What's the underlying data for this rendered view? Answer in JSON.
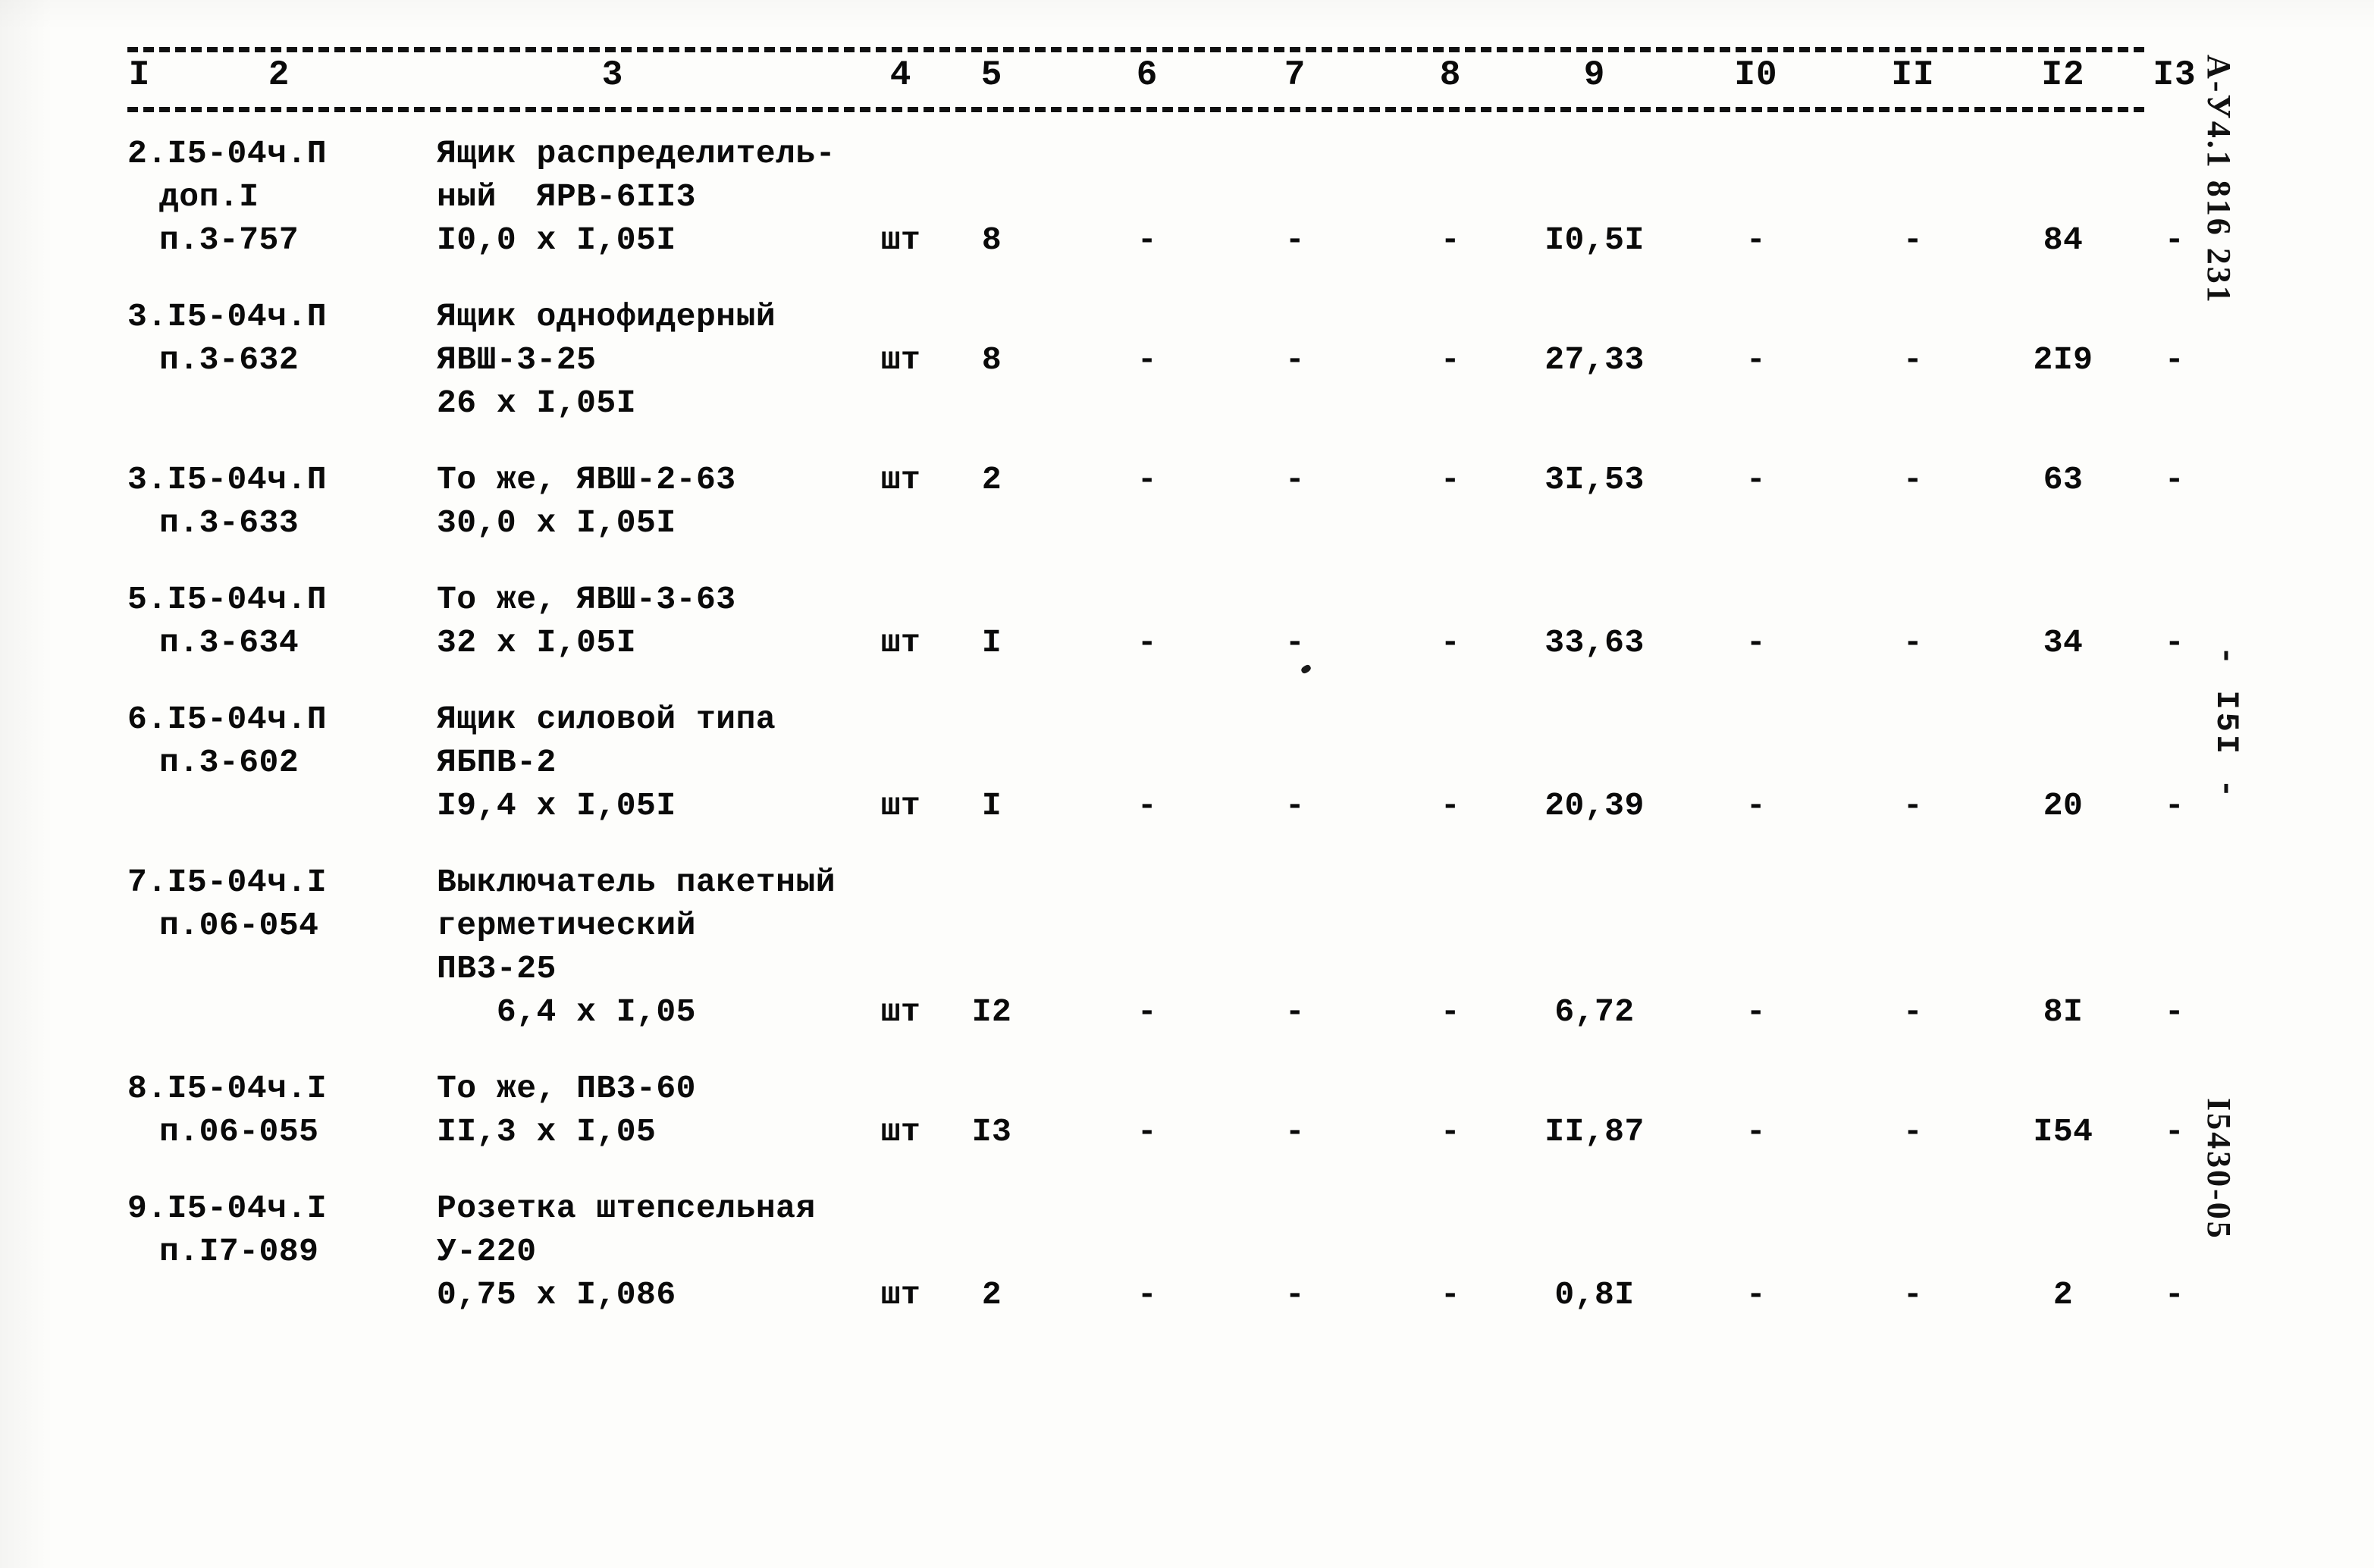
{
  "document": {
    "type": "estimate-table",
    "column_headers": [
      "I",
      "2",
      "3",
      "4",
      "5",
      "6",
      "7",
      "8",
      "9",
      "I0",
      "II",
      "I2",
      "I3"
    ],
    "margin": {
      "top_code": "А-У4.1 816 231",
      "page_number": "- I5I -",
      "bottom_code": "I5430-05"
    }
  },
  "rows": [
    {
      "code_lines": [
        "2.I5-04ч.П",
        "доп.I",
        "п.3-757"
      ],
      "desc_lines": [
        "Ящик распределитель-",
        "ный  ЯРВ-6II3",
        "I0,0 x I,05I"
      ],
      "unit": "шт",
      "qty": "8",
      "c6": "-",
      "c7": "-",
      "c8": "-",
      "c9": "I0,5I",
      "c10": "-",
      "c11": "-",
      "c12": "84",
      "c13": "-",
      "value_line": 2
    },
    {
      "code_lines": [
        "3.I5-04ч.П",
        "п.3-632"
      ],
      "desc_lines": [
        "Ящик однофидерный",
        "ЯВШ-3-25",
        "26 x I,05I"
      ],
      "unit": "шт",
      "qty": "8",
      "c6": "-",
      "c7": "-",
      "c8": "-",
      "c9": "27,33",
      "c10": "-",
      "c11": "-",
      "c12": "2I9",
      "c13": "-",
      "value_line": 1
    },
    {
      "code_lines": [
        "3.I5-04ч.П",
        "п.3-633"
      ],
      "desc_lines": [
        "То же, ЯВШ-2-63",
        "30,0 x I,05I"
      ],
      "unit": "шт",
      "qty": "2",
      "c6": "-",
      "c7": "-",
      "c8": "-",
      "c9": "3I,53",
      "c10": "-",
      "c11": "-",
      "c12": "63",
      "c13": "-",
      "value_line": 0
    },
    {
      "code_lines": [
        "5.I5-04ч.П",
        "п.3-634"
      ],
      "desc_lines": [
        "То же, ЯВШ-3-63",
        "32 x I,05I"
      ],
      "unit": "шт",
      "qty": "I",
      "c6": "-",
      "c7": "-",
      "c8": "-",
      "c9": "33,63",
      "c10": "-",
      "c11": "-",
      "c12": "34",
      "c13": "-",
      "value_line": 1
    },
    {
      "code_lines": [
        "6.I5-04ч.П",
        "п.3-602"
      ],
      "desc_lines": [
        "Ящик силовой типа",
        "ЯБПВ-2",
        "I9,4 x I,05I"
      ],
      "unit": "шт",
      "qty": "I",
      "c6": "-",
      "c7": "-",
      "c8": "-",
      "c9": "20,39",
      "c10": "-",
      "c11": "-",
      "c12": "20",
      "c13": "-",
      "value_line": 2
    },
    {
      "code_lines": [
        "7.I5-04ч.I",
        "п.06-054"
      ],
      "desc_lines": [
        "Выключатель пакетный",
        "герметический",
        "ПВ3-25",
        "   6,4 x I,05"
      ],
      "unit": "шт",
      "qty": "I2",
      "c6": "-",
      "c7": "-",
      "c8": "-",
      "c9": "6,72",
      "c10": "-",
      "c11": "-",
      "c12": "8I",
      "c13": "-",
      "value_line": 3
    },
    {
      "code_lines": [
        "8.I5-04ч.I",
        "п.06-055"
      ],
      "desc_lines": [
        "То же, ПВ3-60",
        "II,3 x I,05"
      ],
      "unit": "шт",
      "qty": "I3",
      "c6": "-",
      "c7": "-",
      "c8": "-",
      "c9": "II,87",
      "c10": "-",
      "c11": "-",
      "c12": "I54",
      "c13": "-",
      "value_line": 1
    },
    {
      "code_lines": [
        "9.I5-04ч.I",
        "п.I7-089"
      ],
      "desc_lines": [
        "Розетка штепсельная",
        "У-220",
        "0,75 x I,086"
      ],
      "unit": "шт",
      "qty": "2",
      "c6": "-",
      "c7": "-",
      "c8": "-",
      "c9": "0,8I",
      "c10": "-",
      "c11": "-",
      "c12": "2",
      "c13": "-",
      "value_line": 2
    }
  ]
}
